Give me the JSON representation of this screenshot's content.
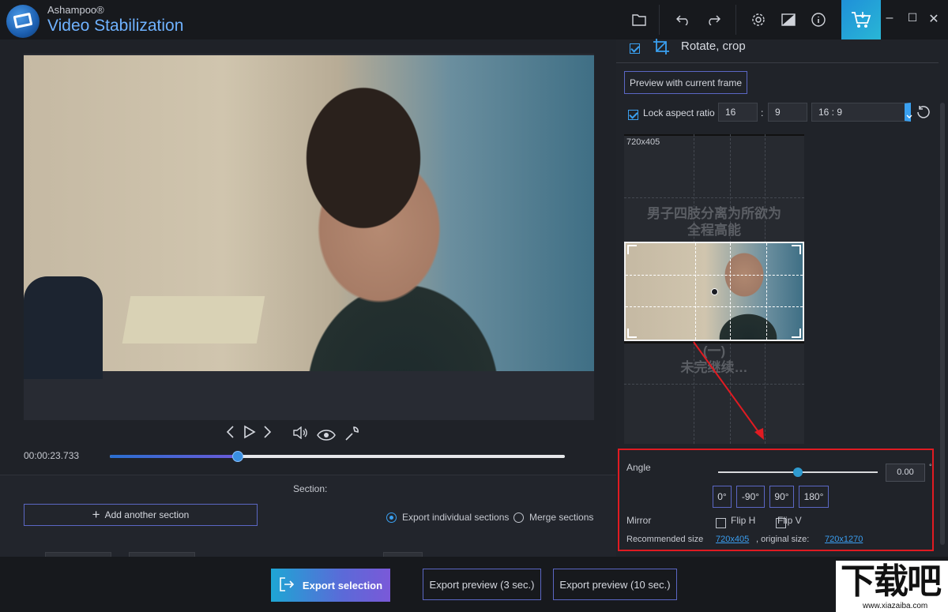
{
  "app": {
    "brand": "Ashampoo®",
    "name": "Video Stabilization"
  },
  "toolbar": {
    "icons": [
      "folder-icon",
      "undo-icon",
      "redo-icon",
      "gear-icon",
      "compare-icon",
      "info-icon",
      "cart-icon"
    ],
    "window_controls": [
      "minimize-icon",
      "maximize-icon",
      "close-icon"
    ]
  },
  "player": {
    "timecode": "00:00:23.733",
    "progress": 0.282,
    "controls": [
      "prev-frame-icon",
      "play-icon",
      "next-frame-icon",
      "volume-icon",
      "eye-icon",
      "wrench-icon"
    ]
  },
  "section": {
    "label": "Section:",
    "add_label": "Add another section",
    "export_individual": "Export individual sections",
    "merge": "Merge sections",
    "selected": "export_individual"
  },
  "right_panel": {
    "header_title": "Rotate, crop",
    "preview_btn": "Preview with current frame",
    "lock_aspect": "Lock aspect ratio",
    "lock_checked": true,
    "ratio_w": "16",
    "ratio_sep": ":",
    "ratio_h": "9",
    "ratio_select": "16 : 9",
    "preview_size": "720x405",
    "overlay_line1": "男子四肢分离为所欲为",
    "overlay_line2": "全程高能",
    "overlay_line3": "(一)",
    "overlay_line4": "未完继续…",
    "angle_label": "Angle",
    "angle_value": "0.00",
    "angle_unit": "°",
    "angle_slider": 0.5,
    "angle_buttons": [
      "0°",
      "-90°",
      "90°",
      "180°"
    ],
    "mirror_label": "Mirror",
    "flip_h": "Flip H",
    "flip_v": "Flip V",
    "recommended_label": "Recommended size",
    "recommended_value": "720x405",
    "original_label": ", original size:",
    "original_value": "720x1270"
  },
  "bottom": {
    "export_selection": "Export selection",
    "export_preview_3": "Export preview (3 sec.)",
    "export_preview_10": "Export preview (10 sec.)"
  },
  "watermark": {
    "text": "下载吧",
    "url": "www.xiazaiba.com"
  },
  "colors": {
    "accent": "#3a9ef0",
    "highlight_border": "#e01b22",
    "button_border": "#5b67c4"
  }
}
